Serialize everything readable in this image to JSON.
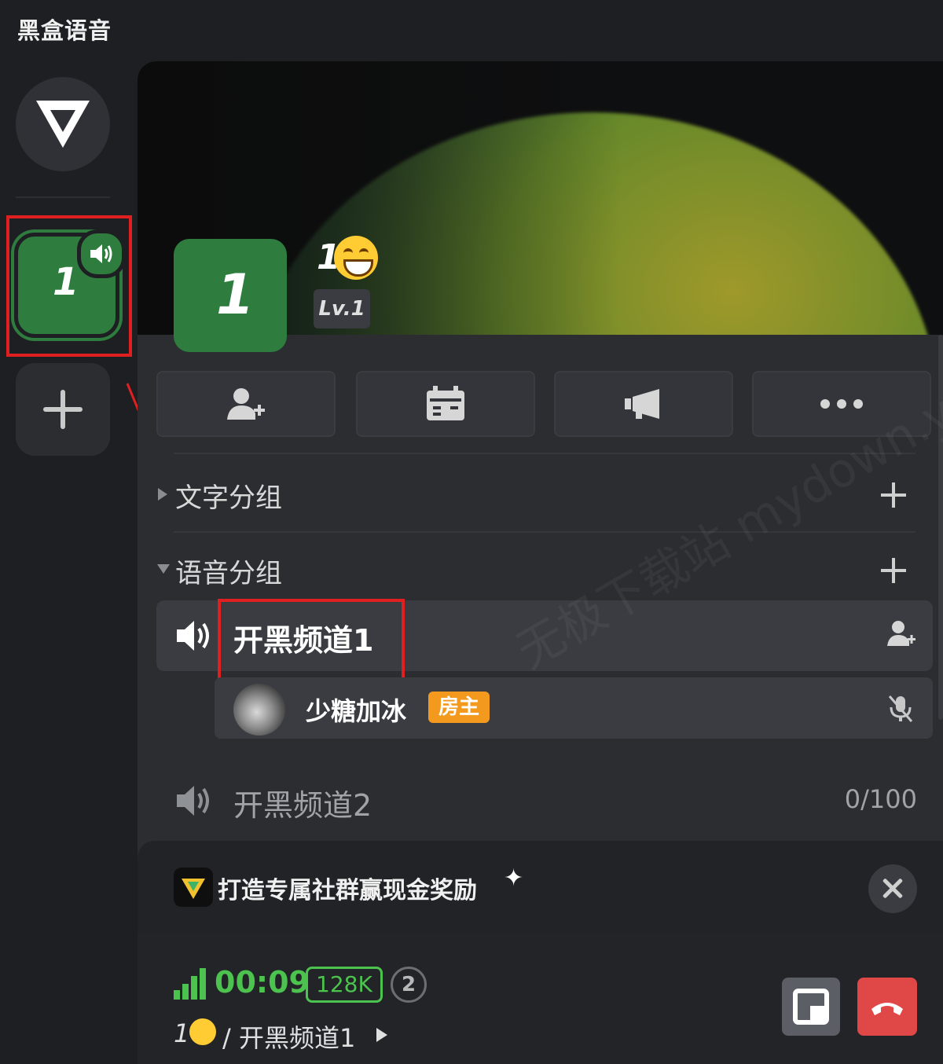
{
  "app": {
    "title": "黑盒语音"
  },
  "server": {
    "tile_label": "1",
    "name": "1",
    "level": "Lv.1"
  },
  "groups": {
    "text_group": "文字分组",
    "voice_group": "语音分组"
  },
  "channels": [
    {
      "name": "开黑频道1",
      "active": true
    },
    {
      "name": "开黑频道2",
      "count": "0/100"
    }
  ],
  "member": {
    "name": "少糖加冰",
    "role": "房主"
  },
  "promo": {
    "text": "打造专属社群赢现金奖励"
  },
  "voice": {
    "timer": "00:09",
    "bitrate": "128K",
    "user_count": "2",
    "path_server": "1",
    "path_channel": "/ 开黑频道1"
  },
  "watermark": "无极下载站 mydown.yesky.com",
  "colors": {
    "accent_green": "#2e7d3e",
    "signal_green": "#4cc24f",
    "owner_orange": "#f39a1e",
    "hangup_red": "#e04747",
    "highlight_red": "#e02020"
  }
}
